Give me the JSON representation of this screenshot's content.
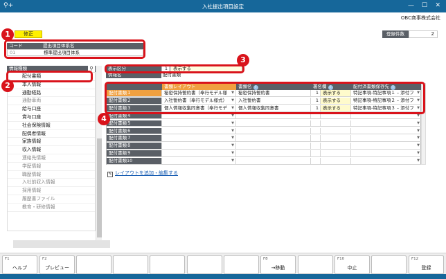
{
  "window": {
    "title": "入社提出項目設定",
    "company": "OBC商事株式会社",
    "quick_icon": "⚲+",
    "controls": [
      "—",
      "☐",
      "✕"
    ]
  },
  "annotations": [
    "1",
    "2",
    "3",
    "4"
  ],
  "mode_label": "修正",
  "code_table": {
    "headers": [
      "コード",
      "提出項目体系名"
    ],
    "row": [
      "01",
      "標準提出項目体系"
    ]
  },
  "count": {
    "label": "登録件数",
    "value": "2"
  },
  "left_panel": {
    "header": "情報種類",
    "items": [
      {
        "label": "配付書類",
        "dim": false
      },
      {
        "label": "本人情報",
        "dim": false
      },
      {
        "label": "通勤経路",
        "dim": false
      },
      {
        "label": "通勤車両",
        "dim": true
      },
      {
        "label": "給与口座",
        "dim": false
      },
      {
        "label": "賞与口座",
        "dim": false
      },
      {
        "label": "社会保険情報",
        "dim": false
      },
      {
        "label": "配偶者情報",
        "dim": false
      },
      {
        "label": "家族情報",
        "dim": false
      },
      {
        "label": "収入情報",
        "dim": false
      },
      {
        "label": "連絡先情報",
        "dim": true
      },
      {
        "label": "学歴情報",
        "dim": true
      },
      {
        "label": "職歴情報",
        "dim": true
      },
      {
        "label": "入社前収入情報",
        "dim": true
      },
      {
        "label": "採用情報",
        "dim": true
      },
      {
        "label": "履歴書ファイル",
        "dim": true
      },
      {
        "label": "教育・研修情報",
        "dim": true
      }
    ]
  },
  "fields": {
    "display_label": "表示区分",
    "display_value": "1",
    "display_text": "表示する",
    "name_label": "情報名",
    "name_value": "配付書類"
  },
  "grid": {
    "headers": [
      "書類レイアウト",
      "書類名",
      "署名欄",
      "配付済書類保存先"
    ],
    "rows": [
      {
        "label": "配付書類１",
        "layout": "秘密保持誓約書（奉行モデル様",
        "name": "秘密保持誓約書",
        "sig_num": "1",
        "sig_text": "表示する",
        "dest": "特記事項-特記事項１ – 添付フ",
        "filled": true
      },
      {
        "label": "配付書類２",
        "layout": "入社誓約書（奉行モデル様式）",
        "name": "入社誓約書",
        "sig_num": "1",
        "sig_text": "表示する",
        "dest": "特記事項-特記事項２ – 添付フ",
        "filled": true
      },
      {
        "label": "配付書類３",
        "layout": "個人情報収集同意書（奉行モデ",
        "name": "個人情報収集同意書",
        "sig_num": "1",
        "sig_text": "表示する",
        "dest": "特記事項-特記事項３ – 添付フ",
        "filled": true
      },
      {
        "label": "配付書類４",
        "layout": "",
        "name": "",
        "sig_num": "",
        "sig_text": "",
        "dest": "",
        "filled": false
      },
      {
        "label": "配付書類５",
        "layout": "",
        "name": "",
        "sig_num": "",
        "sig_text": "",
        "dest": "",
        "filled": false
      },
      {
        "label": "配付書類６",
        "layout": "",
        "name": "",
        "sig_num": "",
        "sig_text": "",
        "dest": "",
        "filled": false
      },
      {
        "label": "配付書類７",
        "layout": "",
        "name": "",
        "sig_num": "",
        "sig_text": "",
        "dest": "",
        "filled": false
      },
      {
        "label": "配付書類８",
        "layout": "",
        "name": "",
        "sig_num": "",
        "sig_text": "",
        "dest": "",
        "filled": false
      },
      {
        "label": "配付書類９",
        "layout": "",
        "name": "",
        "sig_num": "",
        "sig_text": "",
        "dest": "",
        "filled": false
      },
      {
        "label": "配付書類10",
        "layout": "",
        "name": "",
        "sig_num": "",
        "sig_text": "",
        "dest": "",
        "filled": false
      }
    ]
  },
  "layout_link": "レイアウトを追加・編集する",
  "function_keys": [
    {
      "key": "F1",
      "label": "ヘルプ"
    },
    {
      "key": "F2",
      "label": "プレビュー"
    },
    {
      "key": "",
      "label": ""
    },
    {
      "key": "",
      "label": ""
    },
    {
      "key": "",
      "label": ""
    },
    {
      "key": "",
      "label": ""
    },
    {
      "key": "",
      "label": ""
    },
    {
      "key": "F8",
      "label": "→移動"
    },
    {
      "key": "",
      "label": ""
    },
    {
      "key": "F10",
      "label": "中止"
    },
    {
      "key": "",
      "label": ""
    },
    {
      "key": "F12",
      "label": "登録"
    }
  ],
  "colors": {
    "titlebar": "#16679a",
    "annotation": "#d9131b",
    "header_gray": "#5a5f66",
    "active_row": "#f0a040",
    "mode_yellow": "#fff000"
  }
}
